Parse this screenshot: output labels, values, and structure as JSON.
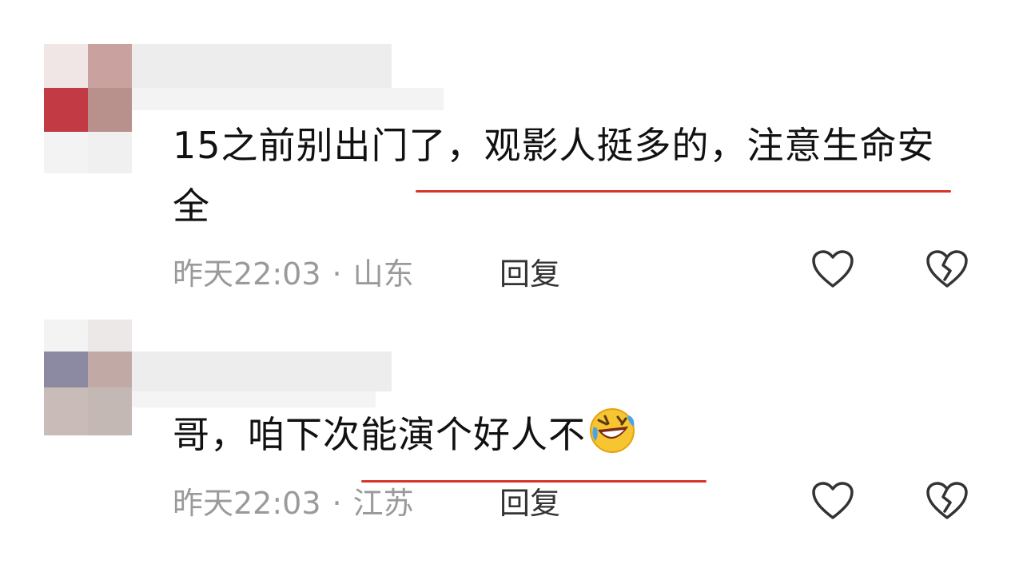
{
  "comments": [
    {
      "text": "15之前别出门了，观影人挺多的，注意生命安全",
      "time": "昨天22:03",
      "separator": "·",
      "location": "山东",
      "reply_label": "回复"
    },
    {
      "text": "哥，咱下次能演个好人不",
      "emoji": "rolling-laughing-emoji",
      "time": "昨天22:03",
      "separator": "·",
      "location": "江苏",
      "reply_label": "回复"
    }
  ],
  "icons": {
    "like": "heart-icon",
    "dislike": "broken-heart-icon"
  },
  "colors": {
    "highlight_underline": "#d9342b",
    "meta_text": "#9a9a9a"
  }
}
